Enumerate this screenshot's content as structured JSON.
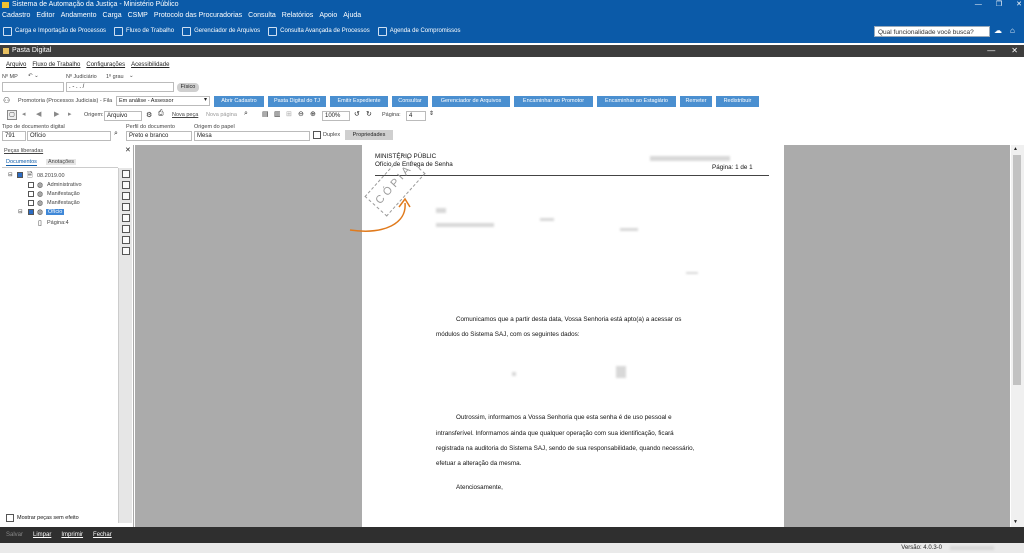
{
  "window": {
    "title": "Sistema de Automação da Justiça - Ministério Público",
    "controls": [
      "—",
      "❐",
      "✕"
    ]
  },
  "menu": [
    "Cadastro",
    "Editor",
    "Andamento",
    "Carga",
    "CSMP",
    "Protocolo das Procuradorias",
    "Consulta",
    "Relatórios",
    "Apoio",
    "Ajuda"
  ],
  "toolbar": [
    {
      "label": "Carga e Importação de Processos",
      "icon": "import-icon"
    },
    {
      "label": "Fluxo de Trabalho",
      "icon": "workflow-icon"
    },
    {
      "label": "Gerenciador de Arquivos",
      "icon": "file-manager-icon"
    },
    {
      "label": "Consulta Avançada de Processos",
      "icon": "advanced-search-icon"
    },
    {
      "label": "Agenda de Compromissos",
      "icon": "calendar-icon"
    }
  ],
  "search": {
    "placeholder": "Qual funcionalidade você busca?"
  },
  "inner": {
    "title": "Pasta Digital",
    "submenu": [
      "Arquivo",
      "Fluxo de Trabalho",
      "Configurações",
      "Acessibilidade"
    ],
    "n_mp_label": "Nº MP",
    "n_judicial_label": "Nº Judiciário",
    "grau": "1º grau",
    "n_judicial_value": ". - . . /",
    "fisico": "Físico",
    "fila_label": "Promotoria (Processos Judiciais) - Fila",
    "fila_value": "Em análise - Assessor",
    "action_buttons": [
      "Abrir Cadastro",
      "Pasta Digital do TJ",
      "Emitir Expediente",
      "Consultar",
      "Gerenciador de Arquivos",
      "Encaminhar ao Promotor",
      "Encaminhar ao Estagiário",
      "Remeter",
      "Redistribuir"
    ],
    "origem_label": "Origem:",
    "origem_value": "Arquivo",
    "nova_peca": "Nova peça",
    "nova_pagina": "Nova página",
    "zoom": "100%",
    "pagina_label": "Página:",
    "pagina_value": "4",
    "tipo_doc_label": "Tipo de documento digital",
    "tipo_doc_code": "791",
    "tipo_doc_value": "Ofício",
    "perfil_label": "Perfil do documento",
    "perfil_value": "Preto e branco",
    "origem_papel_label": "Origem do papel",
    "origem_papel_value": "Mesa",
    "duplex_label": "Duplex",
    "propriedades": "Propriedades"
  },
  "left": {
    "panel_title": "Peças liberadas",
    "tabs": [
      "Documentos",
      "Anotações"
    ],
    "tree": [
      {
        "label": "08.2019.00",
        "level": 0
      },
      {
        "label": "Administrativo",
        "level": 1
      },
      {
        "label": "Manifestação",
        "level": 1
      },
      {
        "label": "Manifestação",
        "level": 1
      },
      {
        "label": "Ofício",
        "level": 1
      },
      {
        "label": "Página:4",
        "level": 2
      }
    ],
    "mostrar": "Mostrar peças sem efeito"
  },
  "doc": {
    "header_left_1": "MINISTÉRIO PÚBLIC",
    "header_left_2": "Ofício de Entrega de Senha",
    "header_right": "Página: 1 de 1",
    "stamp": "CÓPIA",
    "para1_a": "Comunicamos que a partir desta data, Vossa Senhoria está apto(a) a acessar os",
    "para1_b": "módulos do Sistema SAJ, com os seguintes dados:",
    "para2_a": "Outrossim, informamos a Vossa Senhoria que esta senha é de uso pessoal e",
    "para2_b": "intransferível. Informamos ainda que qualquer operação com sua identificação, ficará",
    "para2_c": "registrada na auditoria do Sistema SAJ, sendo de sua responsabilidade, quando necessário,",
    "para2_d": "efetuar a alteração da mesma.",
    "closing": "Atenciosamente,"
  },
  "bottom": [
    "Salvar",
    "Limpar",
    "Imprimir",
    "Fechar"
  ],
  "status": {
    "version": "Versão: 4.0.3-0"
  },
  "colors": {
    "accent": "#0b5aa8",
    "button": "#4a8fd0",
    "arrow": "#e07a1c"
  }
}
